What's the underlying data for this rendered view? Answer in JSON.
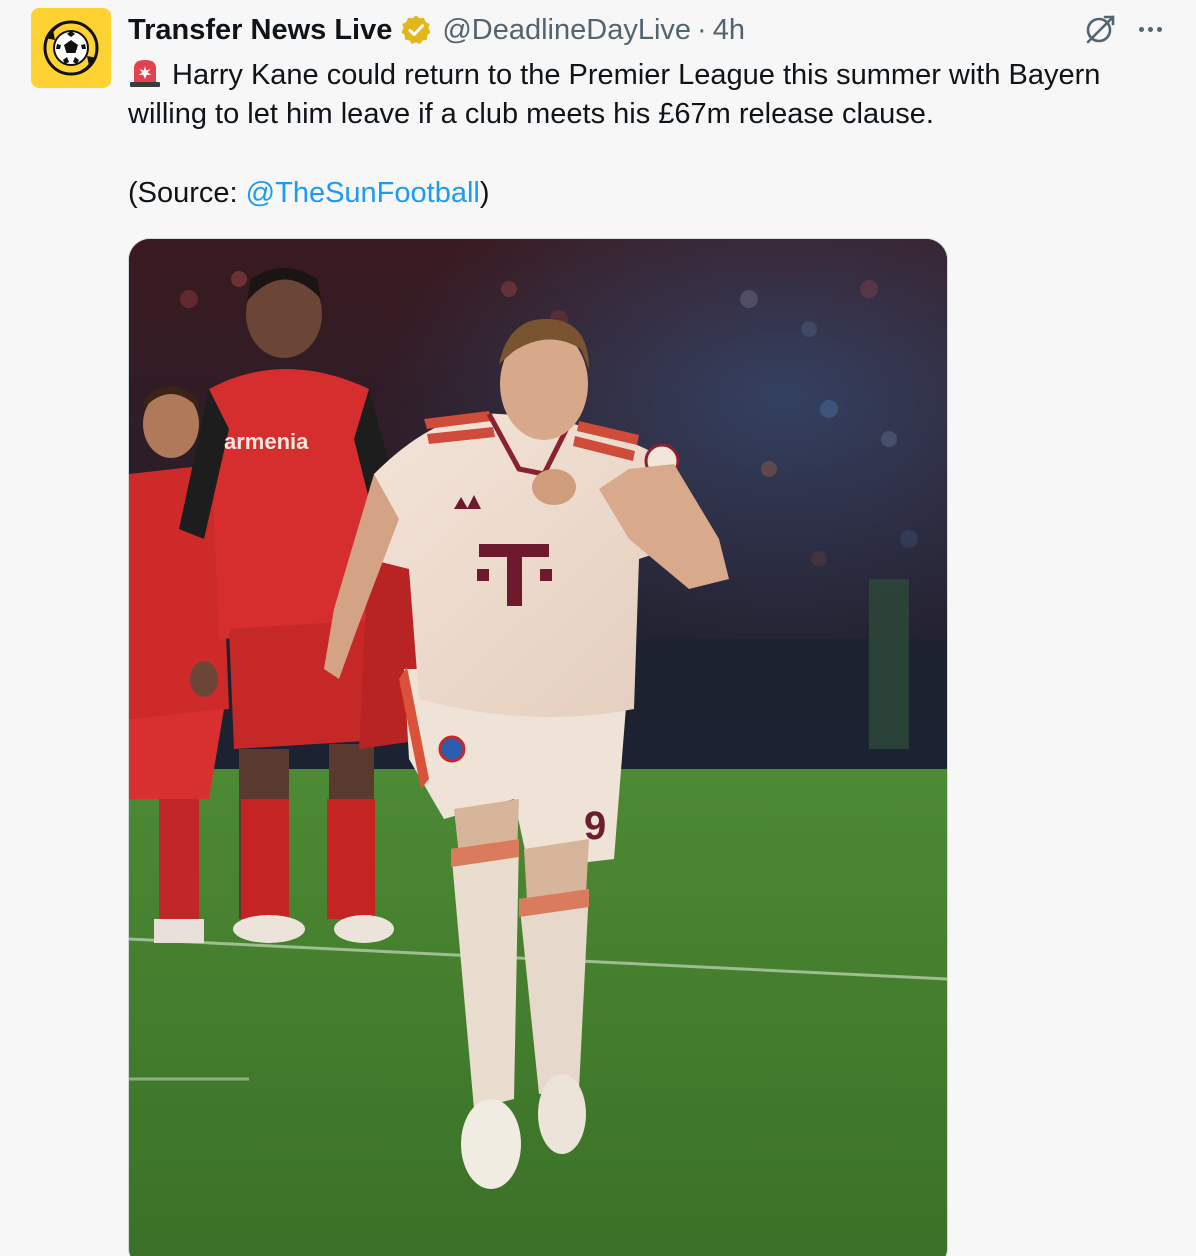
{
  "author": {
    "display_name": "Transfer News Live",
    "handle": "@DeadlineDayLive",
    "separator": "·",
    "time": "4h",
    "avatar_icon": "football-logo-icon",
    "verified_icon": "verified-gold-badge-icon"
  },
  "tweet": {
    "line1": "Harry Kane could return to the Premier League this summer with Bayern",
    "line2": "willing to let him leave if a club meets his £67m release clause.",
    "source_open": "(Source: ",
    "source_mention": "@TheSunFootball",
    "source_close": ")",
    "emoji_icon": "rotating-light-icon"
  },
  "media": {
    "alt": "Harry Kane celebrating in a Bayern Munich shirt"
  },
  "actions": {
    "grok_icon": "grok-icon",
    "more_icon": "more-options-icon"
  },
  "colors": {
    "link": "#1d9bf0",
    "secondary_text": "#536471",
    "avatar_bg": "#ffd234",
    "verified": "#e2b719"
  }
}
